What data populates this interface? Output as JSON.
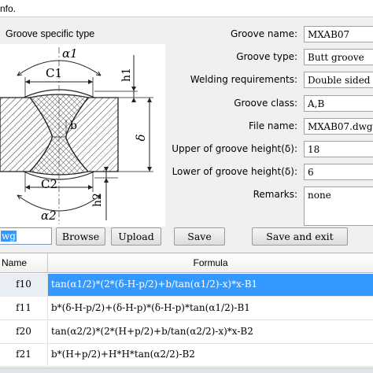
{
  "window": {
    "title": "nfo."
  },
  "drawing": {
    "group_label": "Groove specific type",
    "labels": {
      "a1": "α1",
      "c1": "C1",
      "h1": "h1",
      "b": "b",
      "delta": "δ",
      "c2": "C2",
      "a2": "α2",
      "h2": "h2"
    }
  },
  "form": {
    "groove_name_label": "Groove name:",
    "groove_name": "MXAB07",
    "groove_type_label": "Groove type:",
    "groove_type": "Butt groove",
    "welding_req_label": "Welding requirements:",
    "welding_req": "Double sided w",
    "groove_class_label": "Groove class:",
    "groove_class": "A,B",
    "file_name_label": "File name:",
    "file_name": "MXAB07.dwg",
    "upper_label": "Upper of groove height(δ):",
    "upper": "18",
    "lower_label": "Lower of groove height(δ):",
    "lower": "6",
    "remarks_label": "Remarks:",
    "remarks": "none"
  },
  "toolbar": {
    "file_input": "wg",
    "browse": "Browse",
    "upload": "Upload",
    "save": "Save",
    "save_exit": "Save and exit"
  },
  "table": {
    "headers": {
      "name": "Name",
      "formula": "Formula"
    },
    "rows": [
      {
        "name": "f10",
        "formula": "tan(α1/2)*(2*(δ-H-p/2)+b/tan(α1/2)-x)*x-B1"
      },
      {
        "name": "f11",
        "formula": "b*(δ-H-p/2)+(δ-H-p)*(δ-H-p)*tan(α1/2)-B1"
      },
      {
        "name": "f20",
        "formula": "tan(α2/2)*(2*(H+p/2)+b/tan(α2/2)-x)*x-B2"
      },
      {
        "name": "f21",
        "formula": "b*(H+p/2)+H*H*tan(α2/2)-B2"
      }
    ]
  },
  "colors": {
    "selection": "#3399ff",
    "panel": "#f0f0f0"
  }
}
